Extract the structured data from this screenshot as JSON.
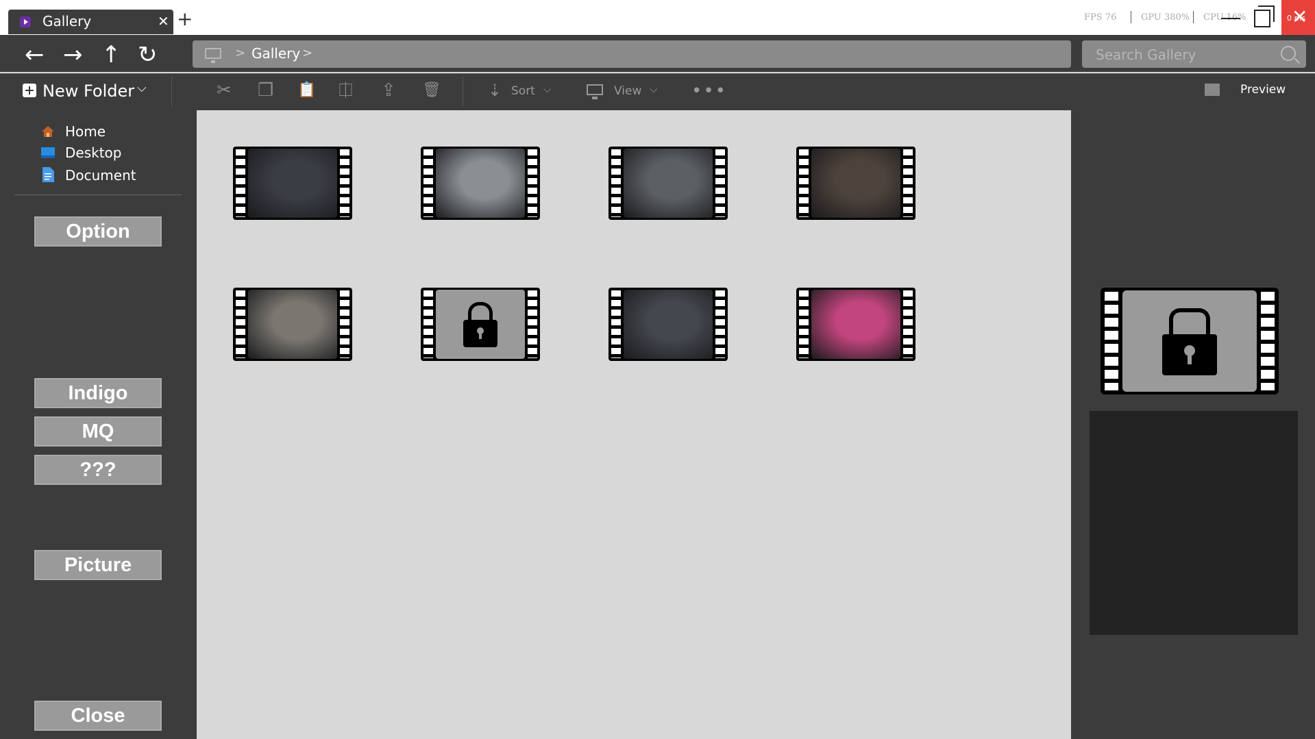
{
  "tab": {
    "title": "Gallery",
    "close": "✕",
    "new_tab": "+"
  },
  "stats": {
    "fps": "FPS 76",
    "gpu": "GPU 380%",
    "cpu": "CPU 16%",
    "ms": "0 ms"
  },
  "window": {
    "close": "✕"
  },
  "nav": {
    "back": "←",
    "forward": "→",
    "up": "↑",
    "refresh": "↻"
  },
  "breadcrumb": {
    "separator": ">",
    "path": "Gallery"
  },
  "search": {
    "placeholder": "Search Gallery"
  },
  "toolbar": {
    "new_folder": "New Folder",
    "caret": "⌵",
    "cut": "✂",
    "copy": "❐",
    "paste": "📋",
    "rename": "⎅",
    "share": "⇪",
    "delete": "🗑",
    "sort_icon": "⇣",
    "sort": "Sort",
    "view": "View",
    "more": "•••",
    "preview": "Preview"
  },
  "sidebar": {
    "nav": [
      {
        "label": "Home",
        "color": "#c0602c"
      },
      {
        "label": "Desktop",
        "color": "#2a8ce0"
      },
      {
        "label": "Document",
        "color": "#4a9ae8"
      }
    ],
    "buttons": {
      "option": "Option",
      "indigo": "Indigo",
      "mq": "MQ",
      "unknown": "???",
      "picture": "Picture",
      "close": "Close"
    }
  },
  "gallery": {
    "items": [
      {
        "locked": false,
        "tone": "#3a3d44"
      },
      {
        "locked": false,
        "tone": "#8a8f94"
      },
      {
        "locked": false,
        "tone": "#5c6064"
      },
      {
        "locked": false,
        "tone": "#4e433c"
      },
      {
        "locked": false,
        "tone": "#7a7670"
      },
      {
        "locked": true,
        "tone": "#9a9a9a"
      },
      {
        "locked": false,
        "tone": "#44474e"
      },
      {
        "locked": false,
        "tone": "#c2457e"
      }
    ]
  },
  "preview": {
    "locked": true
  }
}
